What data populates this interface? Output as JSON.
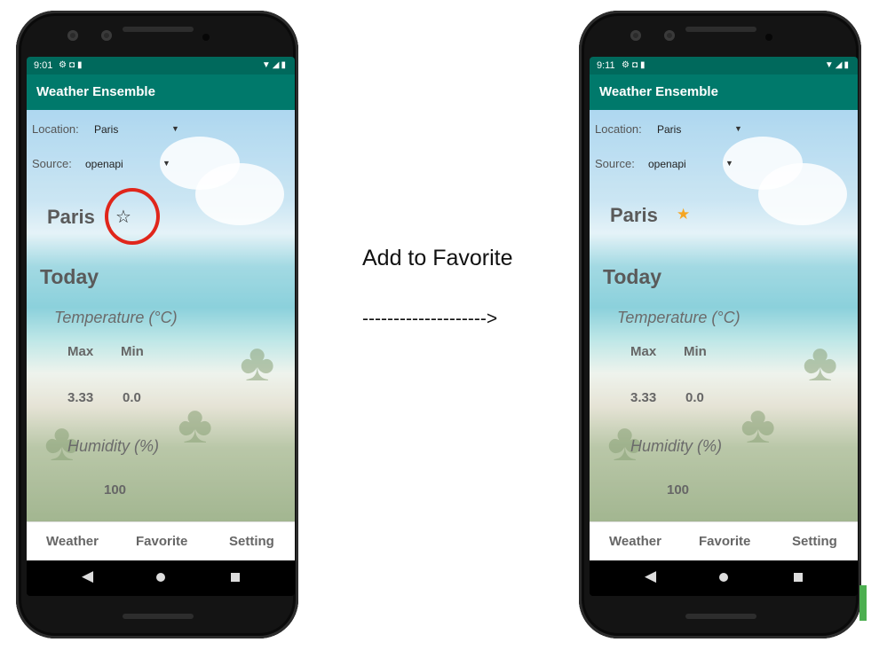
{
  "caption": "Add to Favorite",
  "arrow": "-------------------->",
  "before": {
    "status_time": "9:01",
    "app_title": "Weather Ensemble",
    "location_label": "Location:",
    "location_value": "Paris",
    "source_label": "Source:",
    "source_value": "openapi",
    "city": "Paris",
    "star": "☆",
    "today": "Today",
    "temperature_title": "Temperature (°C)",
    "max_label": "Max",
    "min_label": "Min",
    "max_value": "3.33",
    "min_value": "0.0",
    "humidity_title": "Humidity (%)",
    "humidity_value": "100",
    "tabs": [
      "Weather",
      "Favorite",
      "Setting"
    ]
  },
  "after": {
    "status_time": "9:11",
    "app_title": "Weather Ensemble",
    "location_label": "Location:",
    "location_value": "Paris",
    "source_label": "Source:",
    "source_value": "openapi",
    "city": "Paris",
    "star": "★",
    "today": "Today",
    "temperature_title": "Temperature (°C)",
    "max_label": "Max",
    "min_label": "Min",
    "max_value": "3.33",
    "min_value": "0.0",
    "humidity_title": "Humidity (%)",
    "humidity_value": "100",
    "tabs": [
      "Weather",
      "Favorite",
      "Setting"
    ]
  },
  "colors": {
    "appbar": "#00796b",
    "statusbar": "#00695c",
    "star_filled": "#f5a623",
    "highlight": "#e0261b"
  }
}
